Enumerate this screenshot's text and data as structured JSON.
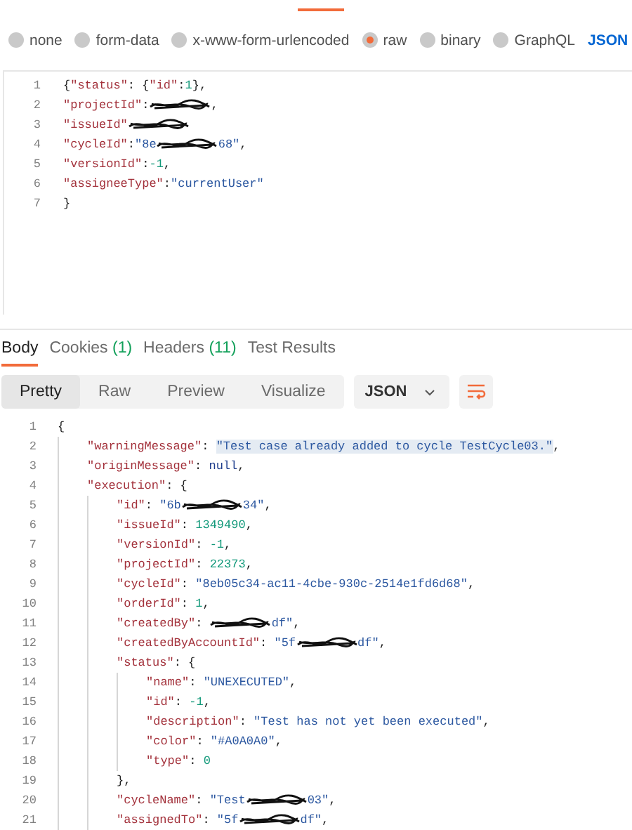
{
  "body_types": [
    {
      "label": "none",
      "selected": false
    },
    {
      "label": "form-data",
      "selected": false
    },
    {
      "label": "x-www-form-urlencoded",
      "selected": false
    },
    {
      "label": "raw",
      "selected": true
    },
    {
      "label": "binary",
      "selected": false
    },
    {
      "label": "GraphQL",
      "selected": false
    }
  ],
  "format_link": "JSON",
  "request_lines": [
    {
      "number": "1",
      "tokens": [
        {
          "kind": "punct",
          "text": "{"
        },
        {
          "kind": "key",
          "text": "\"status\""
        },
        {
          "kind": "punct",
          "text": ": {"
        },
        {
          "kind": "key",
          "text": "\"id\""
        },
        {
          "kind": "punct",
          "text": ":"
        },
        {
          "kind": "number",
          "text": "1"
        },
        {
          "kind": "punct",
          "text": "},"
        }
      ]
    },
    {
      "number": "2",
      "tokens": [
        {
          "kind": "key",
          "text": "\"projectId\""
        },
        {
          "kind": "punct",
          "text": ":"
        },
        {
          "kind": "redacted"
        },
        {
          "kind": "punct",
          "text": ","
        }
      ]
    },
    {
      "number": "3",
      "tokens": [
        {
          "kind": "key",
          "text": "\"issueId\""
        },
        {
          "kind": "redacted"
        }
      ]
    },
    {
      "number": "4",
      "tokens": [
        {
          "kind": "key",
          "text": "\"cycleId\""
        },
        {
          "kind": "punct",
          "text": ":"
        },
        {
          "kind": "string",
          "text": "\"8e"
        },
        {
          "kind": "redacted"
        },
        {
          "kind": "string",
          "text": "68\""
        },
        {
          "kind": "punct",
          "text": ","
        }
      ]
    },
    {
      "number": "5",
      "tokens": [
        {
          "kind": "key",
          "text": "\"versionId\""
        },
        {
          "kind": "punct",
          "text": ":"
        },
        {
          "kind": "number",
          "text": "-1"
        },
        {
          "kind": "punct",
          "text": ","
        }
      ]
    },
    {
      "number": "6",
      "tokens": [
        {
          "kind": "key",
          "text": "\"assigneeType\""
        },
        {
          "kind": "punct",
          "text": ":"
        },
        {
          "kind": "string",
          "text": "\"currentUser\""
        }
      ]
    },
    {
      "number": "7",
      "tokens": [
        {
          "kind": "punct",
          "text": "}"
        }
      ]
    }
  ],
  "response_tabs": [
    {
      "label": "Body",
      "selected": true
    },
    {
      "label": "Cookies",
      "count": "(1)",
      "selected": false
    },
    {
      "label": "Headers",
      "count": "(11)",
      "selected": false
    },
    {
      "label": "Test Results",
      "selected": false
    }
  ],
  "view_modes": [
    {
      "label": "Pretty",
      "selected": true
    },
    {
      "label": "Raw",
      "selected": false
    },
    {
      "label": "Preview",
      "selected": false
    },
    {
      "label": "Visualize",
      "selected": false
    }
  ],
  "format_select": "JSON",
  "response_lines": [
    {
      "number": "1",
      "tokens": [
        {
          "kind": "punct",
          "text": "{"
        }
      ],
      "children": [
        {
          "number": "2",
          "tokens": [
            {
              "kind": "key",
              "text": "\"warningMessage\""
            },
            {
              "kind": "punct",
              "text": ": "
            },
            {
              "kind": "string",
              "text": "\"Test case already added to cycle TestCycle03.\"",
              "highlighted": true
            },
            {
              "kind": "punct",
              "text": ","
            }
          ]
        },
        {
          "number": "3",
          "tokens": [
            {
              "kind": "key",
              "text": "\"originMessage\""
            },
            {
              "kind": "punct",
              "text": ": "
            },
            {
              "kind": "keyword",
              "text": "null"
            },
            {
              "kind": "punct",
              "text": ","
            }
          ]
        },
        {
          "number": "4",
          "tokens": [
            {
              "kind": "key",
              "text": "\"execution\""
            },
            {
              "kind": "punct",
              "text": ": {"
            }
          ],
          "children": [
            {
              "number": "5",
              "tokens": [
                {
                  "kind": "key",
                  "text": "\"id\""
                },
                {
                  "kind": "punct",
                  "text": ": "
                },
                {
                  "kind": "string",
                  "text": "\"6b"
                },
                {
                  "kind": "redacted"
                },
                {
                  "kind": "string",
                  "text": "34\""
                },
                {
                  "kind": "punct",
                  "text": ","
                }
              ]
            },
            {
              "number": "6",
              "tokens": [
                {
                  "kind": "key",
                  "text": "\"issueId\""
                },
                {
                  "kind": "punct",
                  "text": ": "
                },
                {
                  "kind": "number",
                  "text": "1349490"
                },
                {
                  "kind": "punct",
                  "text": ","
                }
              ]
            },
            {
              "number": "7",
              "tokens": [
                {
                  "kind": "key",
                  "text": "\"versionId\""
                },
                {
                  "kind": "punct",
                  "text": ": "
                },
                {
                  "kind": "number",
                  "text": "-1"
                },
                {
                  "kind": "punct",
                  "text": ","
                }
              ]
            },
            {
              "number": "8",
              "tokens": [
                {
                  "kind": "key",
                  "text": "\"projectId\""
                },
                {
                  "kind": "punct",
                  "text": ": "
                },
                {
                  "kind": "number",
                  "text": "22373"
                },
                {
                  "kind": "punct",
                  "text": ","
                }
              ]
            },
            {
              "number": "9",
              "tokens": [
                {
                  "kind": "key",
                  "text": "\"cycleId\""
                },
                {
                  "kind": "punct",
                  "text": ": "
                },
                {
                  "kind": "string",
                  "text": "\"8eb05c34-ac11-4cbe-930c-2514e1fd6d68\""
                },
                {
                  "kind": "punct",
                  "text": ","
                }
              ]
            },
            {
              "number": "10",
              "tokens": [
                {
                  "kind": "key",
                  "text": "\"orderId\""
                },
                {
                  "kind": "punct",
                  "text": ": "
                },
                {
                  "kind": "number",
                  "text": "1"
                },
                {
                  "kind": "punct",
                  "text": ","
                }
              ]
            },
            {
              "number": "11",
              "tokens": [
                {
                  "kind": "key",
                  "text": "\"createdBy\""
                },
                {
                  "kind": "punct",
                  "text": ": "
                },
                {
                  "kind": "redacted"
                },
                {
                  "kind": "string",
                  "text": "df\""
                },
                {
                  "kind": "punct",
                  "text": ","
                }
              ]
            },
            {
              "number": "12",
              "tokens": [
                {
                  "kind": "key",
                  "text": "\"createdByAccountId\""
                },
                {
                  "kind": "punct",
                  "text": ": "
                },
                {
                  "kind": "string",
                  "text": "\"5f"
                },
                {
                  "kind": "redacted"
                },
                {
                  "kind": "string",
                  "text": "df\""
                },
                {
                  "kind": "punct",
                  "text": ","
                }
              ]
            },
            {
              "number": "13",
              "tokens": [
                {
                  "kind": "key",
                  "text": "\"status\""
                },
                {
                  "kind": "punct",
                  "text": ": {"
                }
              ],
              "children": [
                {
                  "number": "14",
                  "tokens": [
                    {
                      "kind": "key",
                      "text": "\"name\""
                    },
                    {
                      "kind": "punct",
                      "text": ": "
                    },
                    {
                      "kind": "string",
                      "text": "\"UNEXECUTED\""
                    },
                    {
                      "kind": "punct",
                      "text": ","
                    }
                  ]
                },
                {
                  "number": "15",
                  "tokens": [
                    {
                      "kind": "key",
                      "text": "\"id\""
                    },
                    {
                      "kind": "punct",
                      "text": ": "
                    },
                    {
                      "kind": "number",
                      "text": "-1"
                    },
                    {
                      "kind": "punct",
                      "text": ","
                    }
                  ]
                },
                {
                  "number": "16",
                  "tokens": [
                    {
                      "kind": "key",
                      "text": "\"description\""
                    },
                    {
                      "kind": "punct",
                      "text": ": "
                    },
                    {
                      "kind": "string",
                      "text": "\"Test has not yet been executed\""
                    },
                    {
                      "kind": "punct",
                      "text": ","
                    }
                  ]
                },
                {
                  "number": "17",
                  "tokens": [
                    {
                      "kind": "key",
                      "text": "\"color\""
                    },
                    {
                      "kind": "punct",
                      "text": ": "
                    },
                    {
                      "kind": "string",
                      "text": "\"#A0A0A0\""
                    },
                    {
                      "kind": "punct",
                      "text": ","
                    }
                  ]
                },
                {
                  "number": "18",
                  "tokens": [
                    {
                      "kind": "key",
                      "text": "\"type\""
                    },
                    {
                      "kind": "punct",
                      "text": ": "
                    },
                    {
                      "kind": "number",
                      "text": "0"
                    }
                  ]
                }
              ]
            },
            {
              "number": "19",
              "tokens": [
                {
                  "kind": "punct",
                  "text": "},"
                }
              ]
            },
            {
              "number": "20",
              "tokens": [
                {
                  "kind": "key",
                  "text": "\"cycleName\""
                },
                {
                  "kind": "punct",
                  "text": ": "
                },
                {
                  "kind": "string",
                  "text": "\"Test"
                },
                {
                  "kind": "redacted"
                },
                {
                  "kind": "string",
                  "text": "03\""
                },
                {
                  "kind": "punct",
                  "text": ","
                }
              ]
            },
            {
              "number": "21",
              "tokens": [
                {
                  "kind": "key",
                  "text": "\"assignedTo\""
                },
                {
                  "kind": "punct",
                  "text": ": "
                },
                {
                  "kind": "string",
                  "text": "\"5f"
                },
                {
                  "kind": "redacted"
                },
                {
                  "kind": "string",
                  "text": "df\""
                },
                {
                  "kind": "punct",
                  "text": ","
                }
              ]
            }
          ]
        }
      ]
    }
  ]
}
